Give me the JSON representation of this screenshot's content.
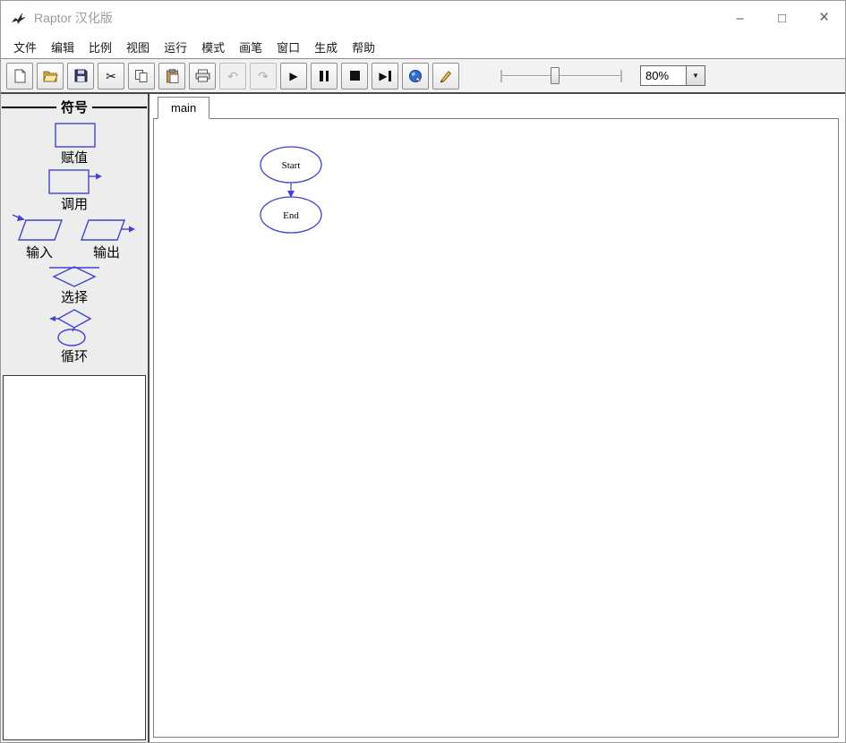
{
  "window": {
    "title": "Raptor 汉化版",
    "controls": {
      "minimize": "–",
      "maximize": "□",
      "close": "×"
    }
  },
  "menu": {
    "items": [
      "文件",
      "编辑",
      "比例",
      "视图",
      "运行",
      "模式",
      "画笔",
      "窗口",
      "生成",
      "帮助"
    ]
  },
  "toolbar": {
    "zoom_value": "80%",
    "glyphs": {
      "cut": "✂",
      "undo": "↶",
      "redo": "↷",
      "play": "▶",
      "step": "▶",
      "dropdown": "▼"
    }
  },
  "symbols_panel": {
    "title": "符号",
    "items": [
      {
        "id": "assignment",
        "label": "赋值"
      },
      {
        "id": "call",
        "label": "调用"
      },
      {
        "id": "input",
        "label": "输入"
      },
      {
        "id": "output",
        "label": "输出"
      },
      {
        "id": "selection",
        "label": "选择"
      },
      {
        "id": "loop",
        "label": "循环"
      }
    ]
  },
  "main": {
    "tab_label": "main",
    "flowchart": {
      "start": "Start",
      "end": "End"
    }
  },
  "colors": {
    "symbol_blue": "#4242d6"
  }
}
